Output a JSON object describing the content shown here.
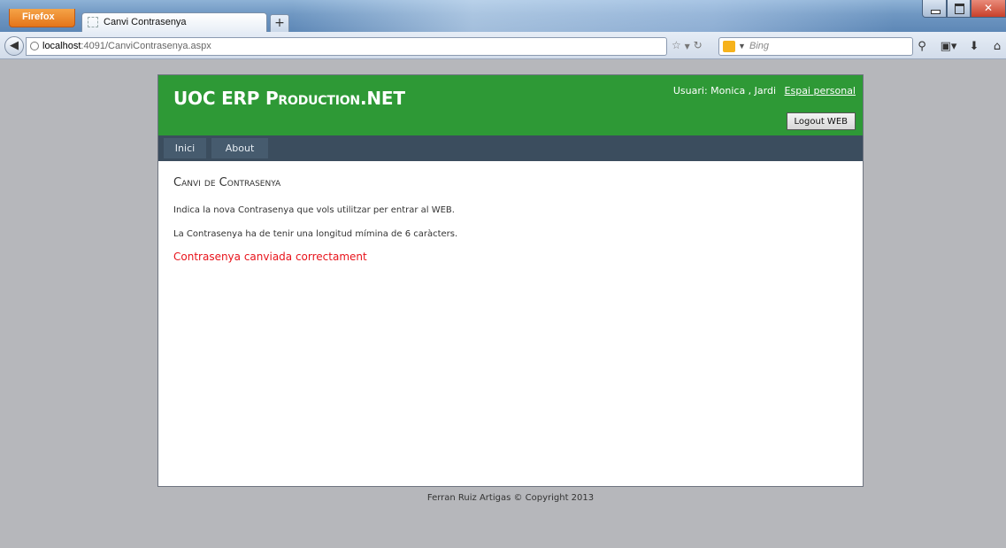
{
  "browser": {
    "firefox_label": "Firefox",
    "tab_title": "Canvi Contrasenya",
    "new_tab_symbol": "+",
    "url_host": "localhost",
    "url_rest": ":4091/CanviContrasenya.aspx",
    "search_placeholder": "Bing"
  },
  "header": {
    "site_title": "UOC ERP Production.NET",
    "user_text": "Usuari: Monica , Jardi",
    "espai_link": "Espai personal",
    "logout_label": "Logout WEB"
  },
  "menu": {
    "items": [
      {
        "label": "Inici"
      },
      {
        "label": "About"
      }
    ]
  },
  "content": {
    "title": "Canvi de Contrasenya",
    "line1": "Indica la nova Contrasenya que vols utilitzar per entrar al WEB.",
    "line2": "La Contrasenya ha de tenir una longitud mímina de 6 caràcters.",
    "success_message": "Contrasenya canviada correctament"
  },
  "footer": {
    "text": "Ferran Ruiz Artigas © Copyright 2013"
  },
  "colors": {
    "header_green": "#2e9936",
    "menu_dark": "#3b4d5e",
    "success_red": "#e8131b",
    "background_gray": "#b6b7bb"
  }
}
